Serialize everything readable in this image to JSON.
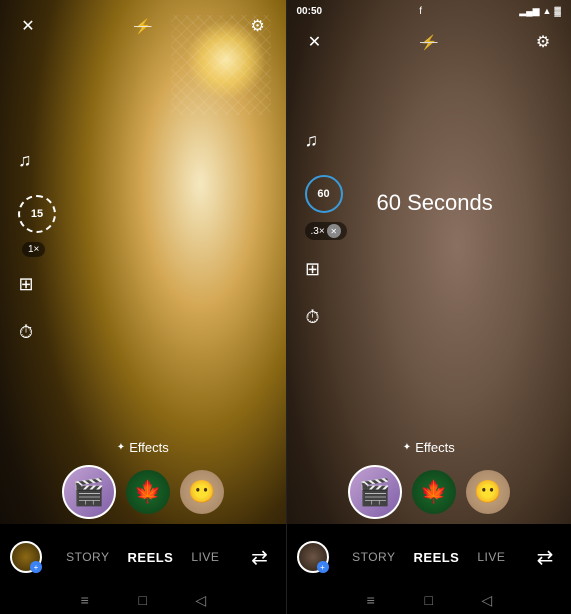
{
  "panels": [
    {
      "id": "left",
      "timer": "15",
      "timer_style": "dashed",
      "speed": "1×",
      "has_speed_x_btn": false,
      "seconds_label": null,
      "effects_label": "Effects",
      "tabs": [
        {
          "label": "STORY",
          "active": false
        },
        {
          "label": "REELS",
          "active": true
        },
        {
          "label": "LIVE",
          "active": false
        }
      ],
      "nav_items": [
        "≡",
        "□",
        "◁"
      ]
    },
    {
      "id": "right",
      "status_time": "00:50",
      "timer": "60",
      "timer_style": "solid",
      "speed": ".3×",
      "has_speed_x_btn": true,
      "seconds_label": "60 Seconds",
      "effects_label": "Effects",
      "tabs": [
        {
          "label": "STORY",
          "active": false
        },
        {
          "label": "REELS",
          "active": true
        },
        {
          "label": "LIVE",
          "active": false
        }
      ],
      "nav_items": [
        "≡",
        "□",
        "◁"
      ]
    }
  ],
  "icons": {
    "close": "✕",
    "flash_off": "⚡",
    "settings": "⚙",
    "music": "♫",
    "grid": "⊞",
    "timer": "⏱",
    "sparkle": "✦",
    "flip": "⇄",
    "plus": "+",
    "hamburger": "≡",
    "square": "□",
    "back": "◁"
  },
  "effects": {
    "reel_icon": "🎬",
    "maple_icon": "🍁",
    "face_icon": "😶"
  }
}
